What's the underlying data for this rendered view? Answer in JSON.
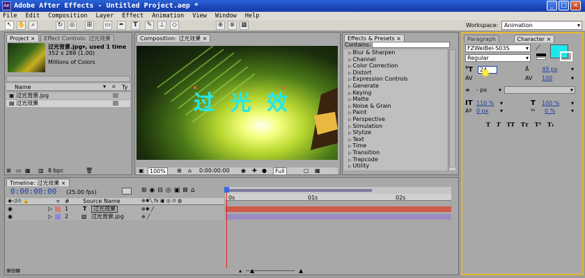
{
  "window": {
    "title": "Adobe After Effects - Untitled Project.aep *",
    "icon_text": "Ae"
  },
  "menu": [
    "File",
    "Edit",
    "Composition",
    "Layer",
    "Effect",
    "Animation",
    "View",
    "Window",
    "Help"
  ],
  "toolbar": {
    "workspace_label": "Workspace:",
    "workspace_value": "Animation",
    "tool_icon_names": [
      "selection-tool",
      "hand-tool",
      "zoom-tool",
      "rotate-tool",
      "orbit-camera-tool",
      "pan-behind-tool",
      "mask-tool",
      "pen-tool",
      "text-tool",
      "brush-tool",
      "eraser-tool",
      "puppet-tool",
      "axis-tool"
    ]
  },
  "project": {
    "tabs": [
      "Project",
      "Effect Controls: 过光效果"
    ],
    "item_name": "过光背景.jpg▾, used 1 time",
    "item_dims": "352 x 288 (1.00)",
    "item_colors": "Millions of Colors",
    "column_name": "Name",
    "column_type": "Ty",
    "items": [
      "过光背景.jpg",
      "过光效果"
    ],
    "bpc": "8 bpc"
  },
  "composition": {
    "tab": "Composition: 过光效果",
    "comp_text": "过 光 效",
    "zoom": "100%",
    "timecode": "0:00:00:00",
    "resolution": "Full"
  },
  "effects": {
    "tab": "Effects & Presets",
    "contains_label": "Contains:",
    "contains_value": "",
    "items": [
      "Blur & Sharpen",
      "Channel",
      "Color Correction",
      "Distort",
      "Expression Controls",
      "Generate",
      "Keying",
      "Matte",
      "Noise & Grain",
      "Paint",
      "Perspective",
      "Simulation",
      "Stylize",
      "Text",
      "Time",
      "Transition",
      "Trapcode",
      "Utility"
    ]
  },
  "character": {
    "tabs": [
      "Paragraph",
      "Character"
    ],
    "font": "FZWeiBei-S03S",
    "style": "Regular",
    "font_size_value": "24",
    "leading": "49 px",
    "kerning": "",
    "tracking": "100",
    "stroke_unit": "- px",
    "vscale": "110 %",
    "hscale": "100 %",
    "baseline": "0 px",
    "tsume": "0 %",
    "format_buttons": [
      "T",
      "T",
      "TT",
      "Tᴛ",
      "T¹",
      "T₁"
    ],
    "fill_color": "#1ee8ee",
    "stroke_color": "#ffffff"
  },
  "timeline": {
    "tab": "Timeline: 过光效果",
    "timecode": "0:00:00:00",
    "fps": "(25.00 fps)",
    "source_name_header": "Source Name",
    "num_header": "#",
    "ruler_labels": [
      "0s",
      "01s",
      "02s"
    ],
    "layers": [
      {
        "num": "1",
        "type": "T",
        "name": "过光效果",
        "label_color": "#d97a7a",
        "bar_color": "#cf5a4a"
      },
      {
        "num": "2",
        "type": "img",
        "name": "过光背景.jpg",
        "label_color": "#8a8ad8",
        "bar_color": "#9a8cc0"
      }
    ]
  }
}
